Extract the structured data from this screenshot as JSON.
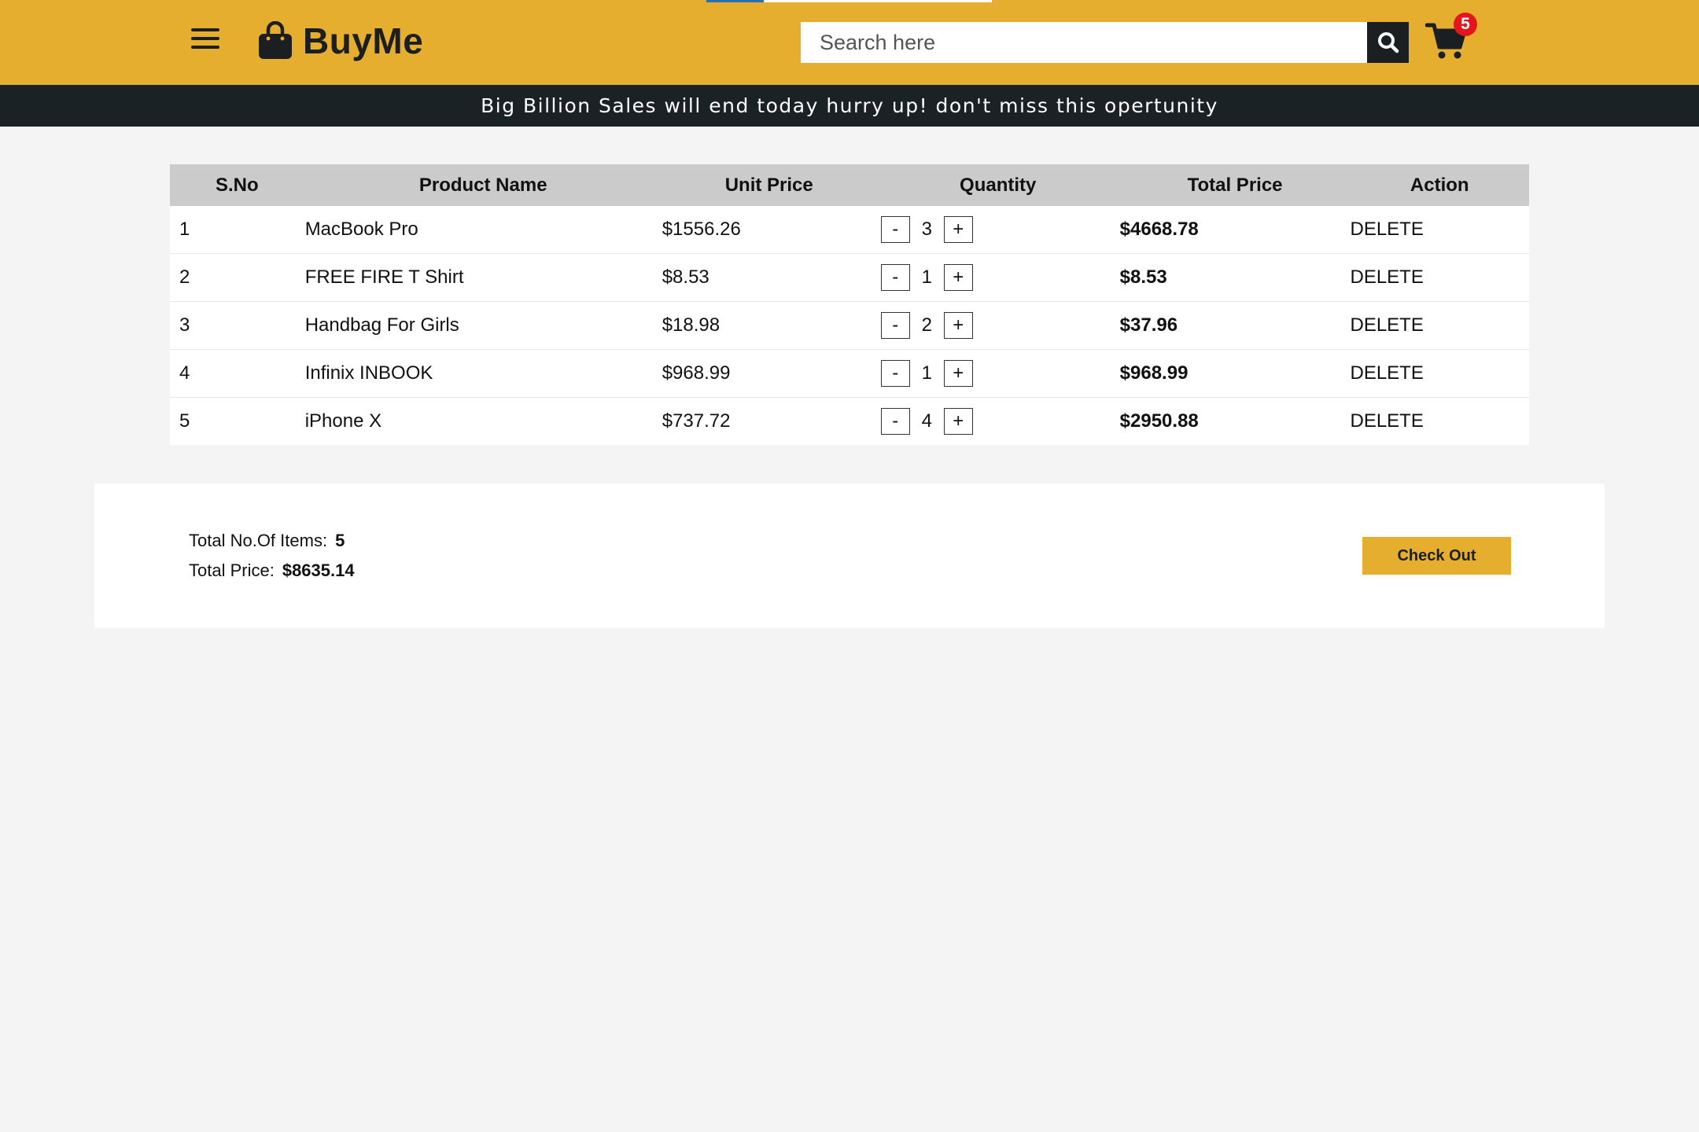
{
  "header": {
    "brand": "BuyMe",
    "search_placeholder": "Search here",
    "cart_count": "5",
    "accent_color": "#e6ae2f",
    "dark_color": "#1b1f22"
  },
  "promo": {
    "text": "Big Billion Sales will end today hurry up! don't miss this opertunity"
  },
  "table": {
    "headers": {
      "sno": "S.No",
      "name": "Product Name",
      "unit": "Unit Price",
      "qty": "Quantity",
      "total": "Total Price",
      "action": "Action"
    },
    "rows": [
      {
        "sno": "1",
        "name": "MacBook Pro",
        "unit": "$1556.26",
        "qty": "3",
        "total": "$4668.78",
        "action": "DELETE"
      },
      {
        "sno": "2",
        "name": "FREE FIRE T Shirt",
        "unit": "$8.53",
        "qty": "1",
        "total": "$8.53",
        "action": "DELETE"
      },
      {
        "sno": "3",
        "name": "Handbag For Girls",
        "unit": "$18.98",
        "qty": "2",
        "total": "$37.96",
        "action": "DELETE"
      },
      {
        "sno": "4",
        "name": "Infinix INBOOK",
        "unit": "$968.99",
        "qty": "1",
        "total": "$968.99",
        "action": "DELETE"
      },
      {
        "sno": "5",
        "name": "iPhone X",
        "unit": "$737.72",
        "qty": "4",
        "total": "$2950.88",
        "action": "DELETE"
      }
    ],
    "minus_label": "-",
    "plus_label": "+"
  },
  "summary": {
    "items_label": "Total No.Of Items:",
    "items_value": "5",
    "price_label": "Total Price:",
    "price_value": "$8635.14",
    "checkout_label": "Check Out"
  }
}
